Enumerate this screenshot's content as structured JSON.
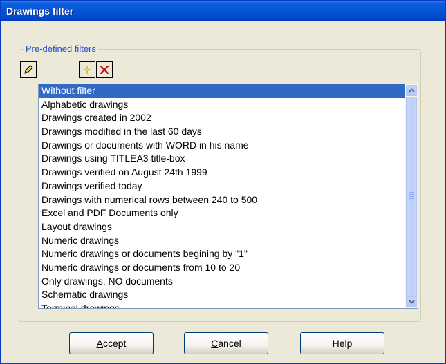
{
  "window": {
    "title": "Drawings filter"
  },
  "group": {
    "label": "Pre-defined filters"
  },
  "toolbar": {
    "edit_icon": "pencil-icon",
    "new_icon": "sparkle-icon",
    "delete_icon": "red-x-icon"
  },
  "list": {
    "selected_index": 0,
    "items": [
      "Without filter",
      "Alphabetic drawings",
      "Drawings created in 2002",
      "Drawings modified in the last 60 days",
      "Drawings or documents with WORD in his name",
      "Drawings using TITLEA3 title-box",
      "Drawings verified on August 24th 1999",
      "Drawings verified today",
      "Drawings with numerical rows between 240 to 500",
      "Excel and PDF Documents only",
      "Layout drawings",
      "Numeric drawings",
      "Numeric drawings or documents begining by \"1\"",
      "Numeric drawings or documents from 10 to 20",
      "Only drawings, NO documents",
      "Schematic drawings",
      "Terminal drawings"
    ]
  },
  "buttons": {
    "accept_mnemonic": "A",
    "accept_rest": "ccept",
    "cancel_mnemonic": "C",
    "cancel_rest": "ancel",
    "help": "Help"
  },
  "colors": {
    "title_bar": "#0554d6",
    "selection": "#316ac5",
    "dialog_bg": "#ece9d8",
    "group_label": "#1d4fd0"
  }
}
